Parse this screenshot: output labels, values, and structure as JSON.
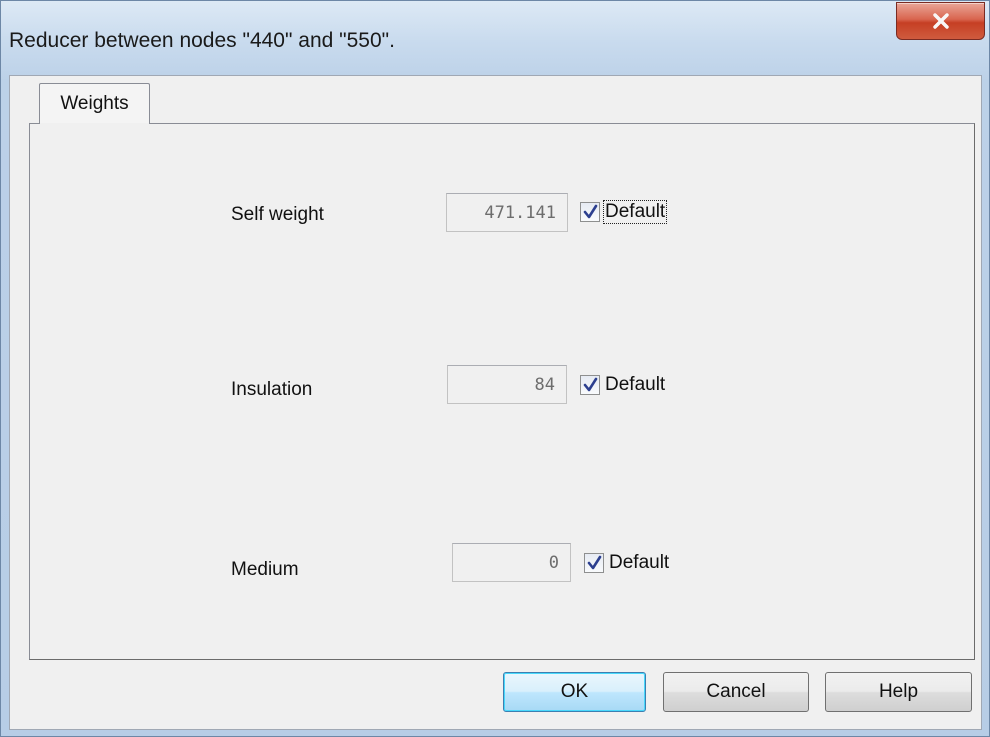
{
  "window": {
    "title": "Reducer between nodes \"440\" and \"550\"."
  },
  "tabs": [
    {
      "label": "Weights"
    }
  ],
  "fields": {
    "self_weight": {
      "label": "Self weight",
      "value": "471.141",
      "checkbox_label": "Default",
      "checked": true
    },
    "insulation": {
      "label": "Insulation",
      "value": "84",
      "checkbox_label": "Default",
      "checked": true
    },
    "medium": {
      "label": "Medium",
      "value": "0",
      "checkbox_label": "Default",
      "checked": true
    }
  },
  "buttons": {
    "ok": "OK",
    "cancel": "Cancel",
    "help": "Help"
  },
  "icons": {
    "close": "close-icon",
    "check": "checkmark-icon"
  },
  "colors": {
    "close_button": "#c63f24",
    "checkmark": "#2c3f8f",
    "default_button_border": "#3c7fb1"
  }
}
